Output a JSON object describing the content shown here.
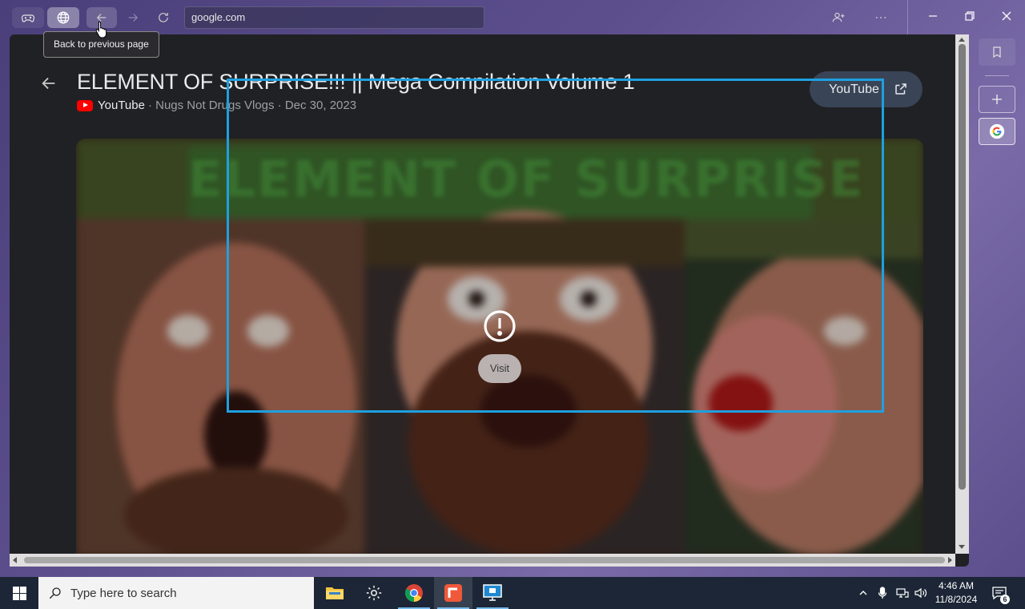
{
  "browser": {
    "url": "google.com",
    "tooltip": "Back to previous page"
  },
  "result": {
    "title": "ELEMENT OF SURPRISE!!! || Mega Compilation Volume 1",
    "source": "YouTube",
    "channel": "· Nugs Not Drugs Vlogs · Dec 30, 2023",
    "open_button": "YouTube",
    "thumbnail_text": "ELEMENT OF SURPRISE",
    "visit_label": "Visit"
  },
  "taskbar": {
    "search_placeholder": "Type here to search",
    "time": "4:46 AM",
    "date": "11/8/2024",
    "notification_count": "6"
  },
  "colors": {
    "highlight": "#1ea0e0",
    "youtube_red": "#ff0000",
    "panel_bg": "#202124"
  }
}
